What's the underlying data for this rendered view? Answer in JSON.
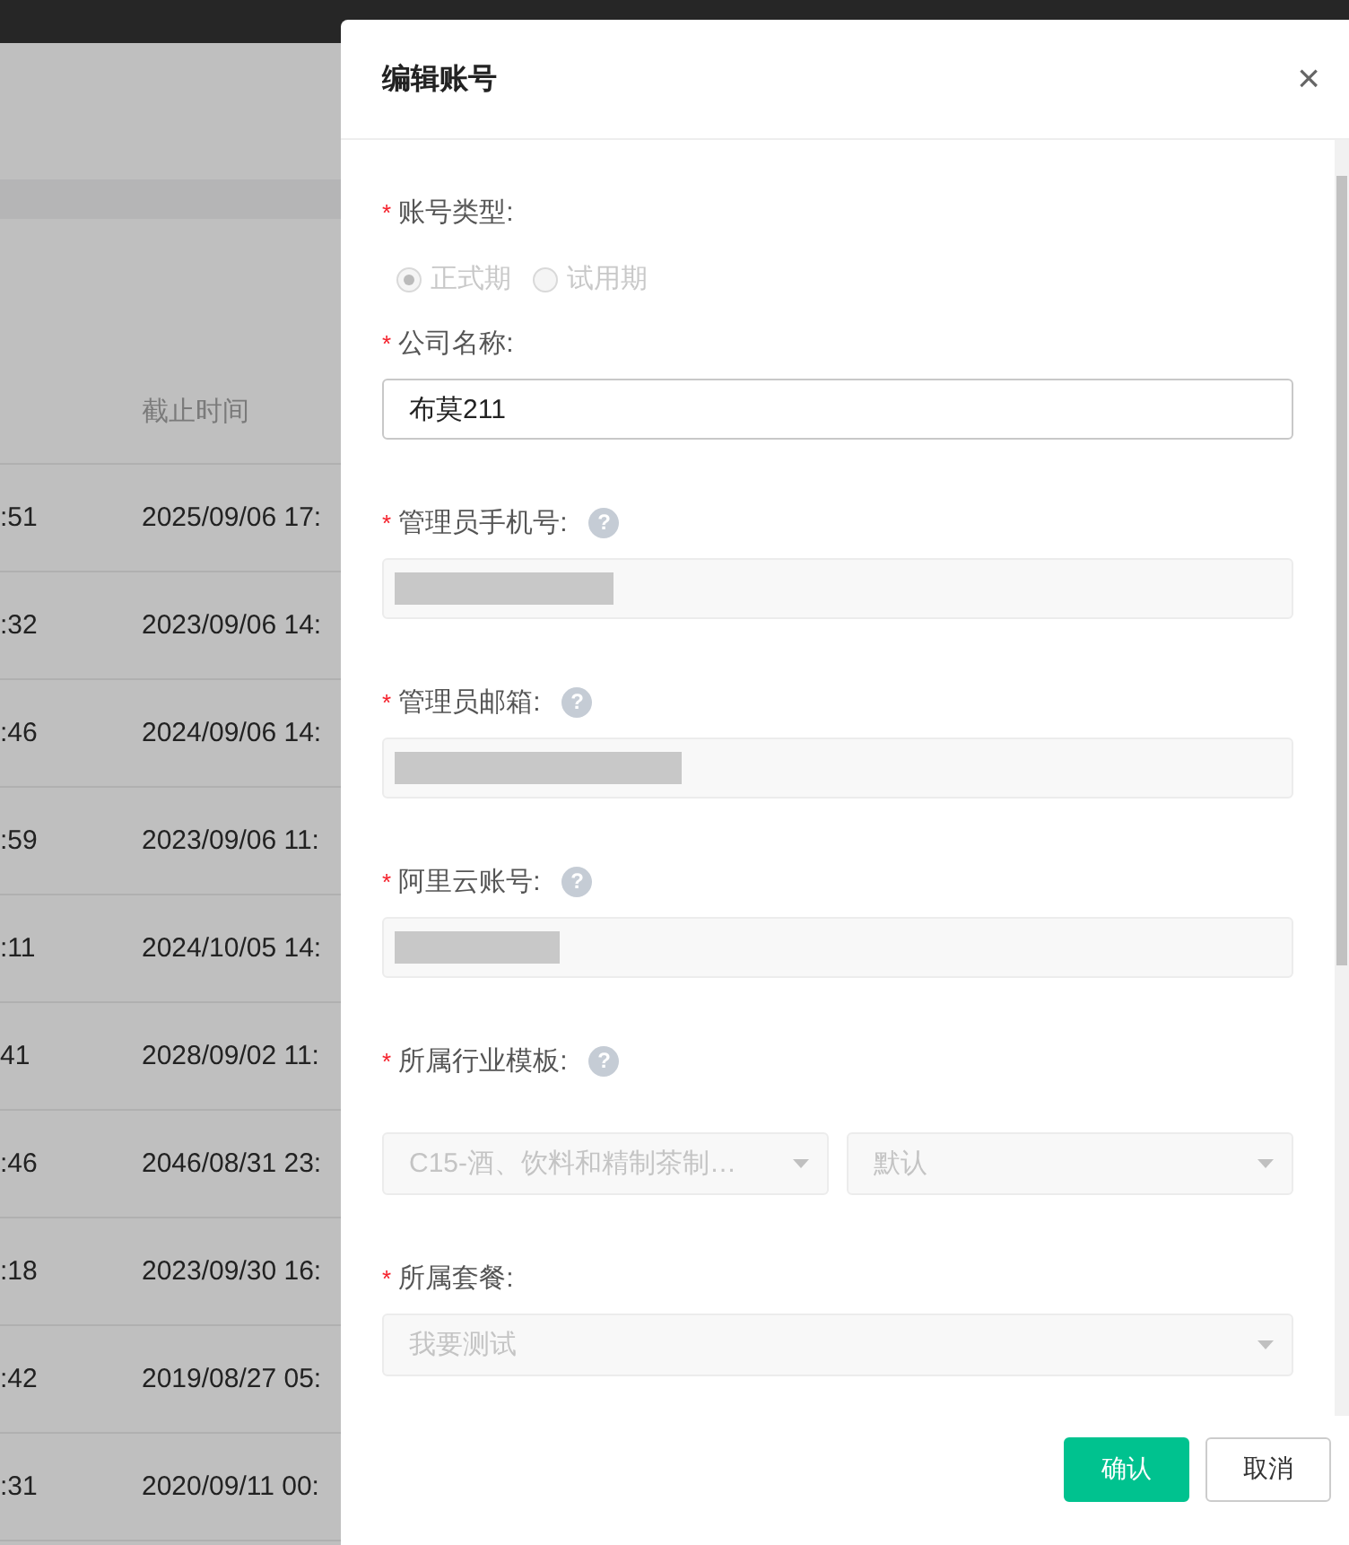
{
  "table": {
    "column_header": "截止时间",
    "rows": [
      {
        "column_1": ":51",
        "deadline": "2025/09/06 17:"
      },
      {
        "column_1": ":32",
        "deadline": "2023/09/06 14:"
      },
      {
        "column_1": ":46",
        "deadline": "2024/09/06 14:"
      },
      {
        "column_1": ":59",
        "deadline": "2023/09/06 11:"
      },
      {
        "column_1": ":11",
        "deadline": "2024/10/05 14:"
      },
      {
        "column_1": "41",
        "deadline": "2028/09/02 11:"
      },
      {
        "column_1": ":46",
        "deadline": "2046/08/31 23:"
      },
      {
        "column_1": ":18",
        "deadline": "2023/09/30 16:"
      },
      {
        "column_1": ":42",
        "deadline": "2019/08/27 05:"
      },
      {
        "column_1": ":31",
        "deadline": "2020/09/11 00:"
      }
    ]
  },
  "dialog": {
    "title": "编辑账号",
    "close": "×",
    "fields": [
      {
        "kind": "radio",
        "label": "账号类型:",
        "required_mark": "*",
        "disabled": true,
        "options": [
          {
            "label": "正式期",
            "selected": true
          },
          {
            "label": "试用期",
            "selected": false
          }
        ]
      },
      {
        "kind": "input",
        "label": "公司名称:",
        "required_mark": "*",
        "disabled": false,
        "value": "布莫211"
      },
      {
        "kind": "input",
        "label": "管理员手机号:",
        "required_mark": "*",
        "help": "?",
        "disabled": true,
        "redacted": true
      },
      {
        "kind": "input",
        "label": "管理员邮箱:",
        "required_mark": "*",
        "help": "?",
        "disabled": true,
        "redacted": true
      },
      {
        "kind": "input",
        "label": "阿里云账号:",
        "required_mark": "*",
        "help": "?",
        "disabled": true,
        "redacted": true
      },
      {
        "kind": "selects",
        "label": "所属行业模板:",
        "required_mark": "*",
        "help": "?",
        "disabled": true,
        "values": [
          "C15-酒、饮料和精制茶制…",
          "默认"
        ]
      },
      {
        "kind": "selects",
        "label": "所属套餐:",
        "required_mark": "*",
        "disabled": true,
        "values": [
          "我要测试"
        ]
      }
    ],
    "buttons": [
      {
        "label": "确认",
        "kind": "primary"
      },
      {
        "label": "取消",
        "kind": "default"
      }
    ]
  }
}
